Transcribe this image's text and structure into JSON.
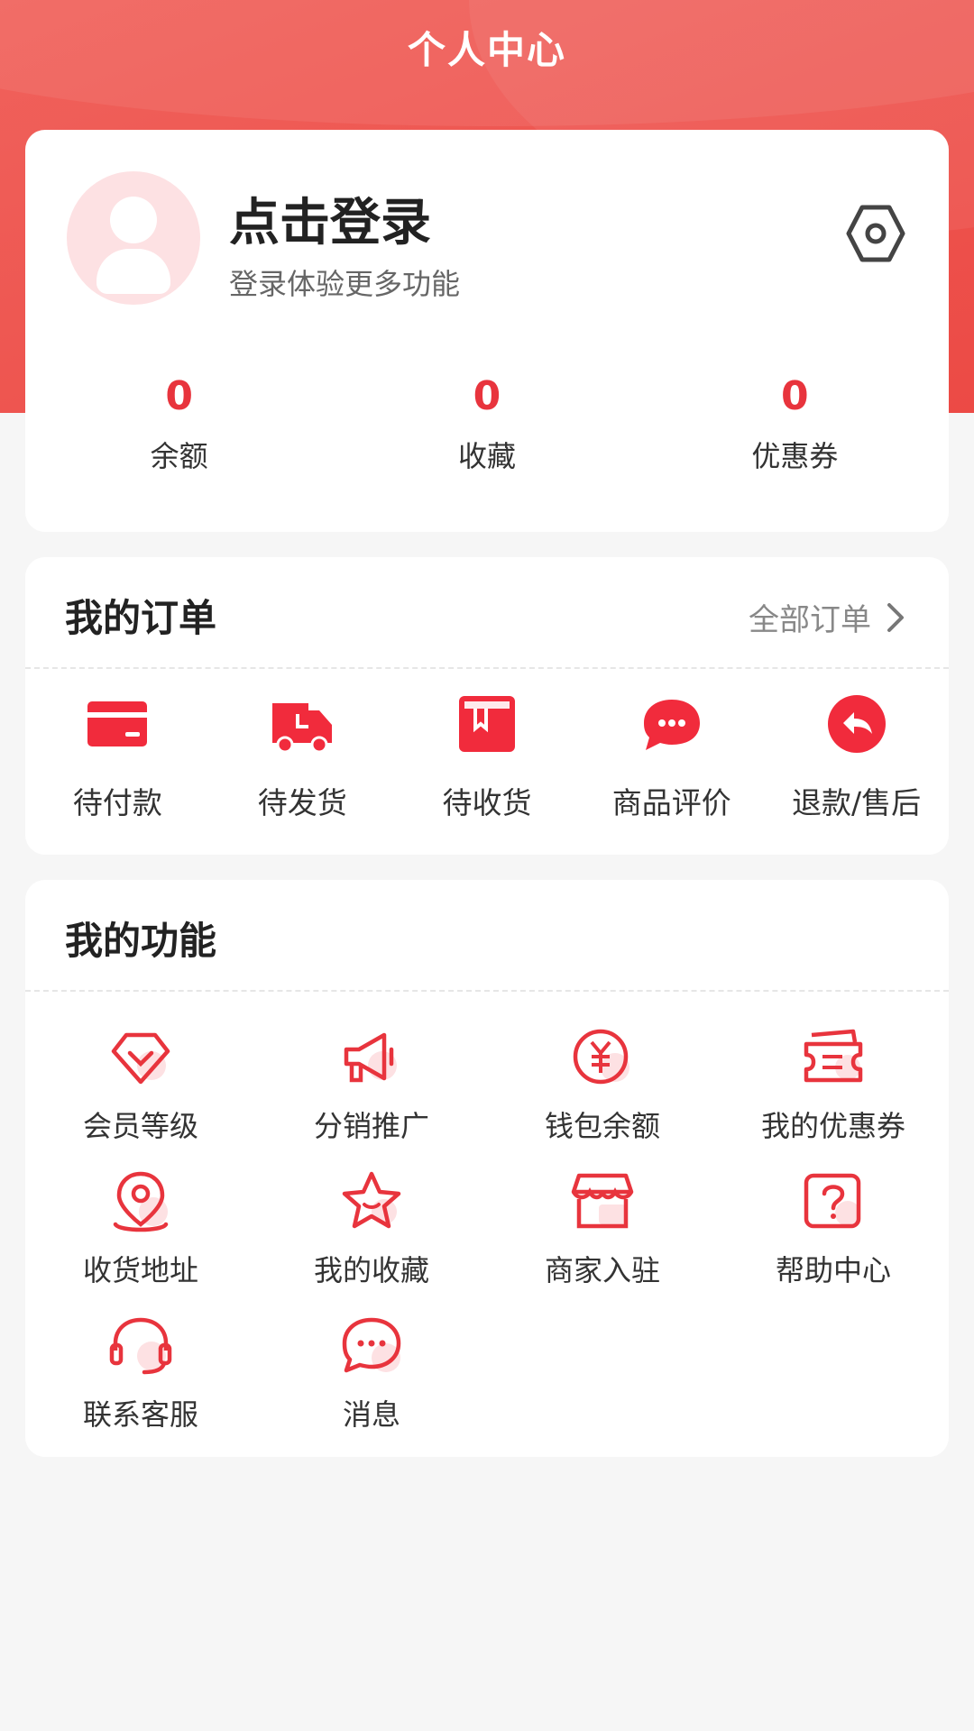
{
  "header": {
    "title": "个人中心"
  },
  "profile": {
    "login_title": "点击登录",
    "login_subtitle": "登录体验更多功能",
    "stats": [
      {
        "value": "0",
        "label": "余额"
      },
      {
        "value": "0",
        "label": "收藏"
      },
      {
        "value": "0",
        "label": "优惠券"
      }
    ]
  },
  "orders": {
    "title": "我的订单",
    "all_label": "全部订单",
    "items": [
      {
        "label": "待付款",
        "icon": "card-icon"
      },
      {
        "label": "待发货",
        "icon": "truck-icon"
      },
      {
        "label": "待收货",
        "icon": "package-icon"
      },
      {
        "label": "商品评价",
        "icon": "chat-bubble-icon"
      },
      {
        "label": "退款/售后",
        "icon": "return-icon"
      }
    ]
  },
  "functions": {
    "title": "我的功能",
    "items": [
      {
        "label": "会员等级",
        "icon": "diamond-icon"
      },
      {
        "label": "分销推广",
        "icon": "megaphone-icon"
      },
      {
        "label": "钱包余额",
        "icon": "yen-coin-icon"
      },
      {
        "label": "我的优惠券",
        "icon": "ticket-icon"
      },
      {
        "label": "收货地址",
        "icon": "location-pin-icon"
      },
      {
        "label": "我的收藏",
        "icon": "star-icon"
      },
      {
        "label": "商家入驻",
        "icon": "store-icon"
      },
      {
        "label": "帮助中心",
        "icon": "question-icon"
      },
      {
        "label": "联系客服",
        "icon": "headset-icon"
      },
      {
        "label": "消息",
        "icon": "message-icon"
      }
    ]
  },
  "colors": {
    "brand": "#ec4a45",
    "accent": "#e8343d",
    "background": "#f6f6f6"
  }
}
